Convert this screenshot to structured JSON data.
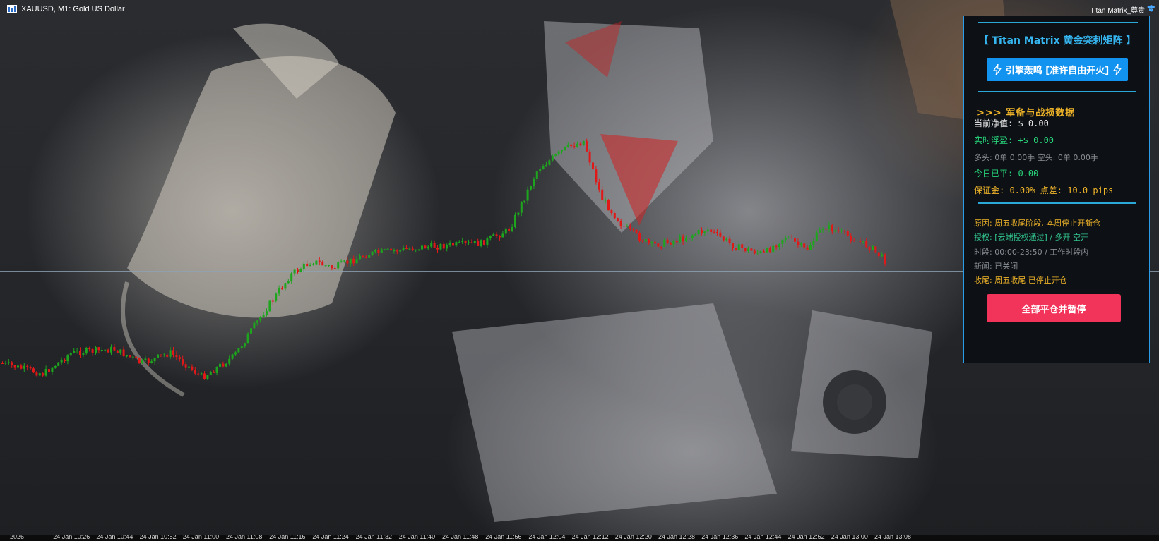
{
  "chart": {
    "symbol_title": "XAUUSD, M1:  Gold US Dollar",
    "ea_name": "Titan Matrix_尊贵",
    "icons": {
      "chart": "chart-window-icon",
      "cap": "graduation-cap-icon"
    },
    "time_axis_labels": [
      "2026",
      "24 Jan 10:26",
      "24 Jan 10:44",
      "24 Jan 10:52",
      "24 Jan 11:00",
      "24 Jan 11:08",
      "24 Jan 11:16",
      "24 Jan 11:24",
      "24 Jan 11:32",
      "24 Jan 11:40",
      "24 Jan 11:48",
      "24 Jan 11:56",
      "24 Jan 12:04",
      "24 Jan 12:12",
      "24 Jan 12:20",
      "24 Jan 12:28",
      "24 Jan 12:36",
      "24 Jan 12:44",
      "24 Jan 12:52",
      "24 Jan 13:00",
      "24 Jan 13:08"
    ],
    "colors": {
      "bull": "#1ea51e",
      "bear": "#e01818",
      "price_line": "#8ea2b4"
    }
  },
  "panel": {
    "title": "【 Titan Matrix 黄金突刺矩阵 】",
    "engine_button": "引擎轰鸣 [准许自由开火]",
    "section_title": ">>> 军备与战损数据",
    "equity": "当前净值:  $ 0.00",
    "floating": "实时浮盈:  +$ 0.00",
    "positions": "多头: 0单 0.00手  空头: 0单 0.00手",
    "closed_today": "今日已平:  0.00",
    "margin_spread": "保证金: 0.00%  点差: 10.0 pips",
    "reason": "原因: 周五收尾阶段, 本周停止开新仓",
    "auth": "授权: [云端授权通过] / 多开 空开",
    "hours": "时段: 00:00-23:50 / 工作时段内",
    "news": "新闻: 已关闭",
    "close_status": "收尾: 周五收尾 已停止开仓",
    "stop_button": "全部平仓并暂停",
    "colors": {
      "accent": "#2a9de8",
      "button": "#1393f0",
      "stop": "#f2335a",
      "section": "#f0b429",
      "green": "#27d47a"
    }
  }
}
